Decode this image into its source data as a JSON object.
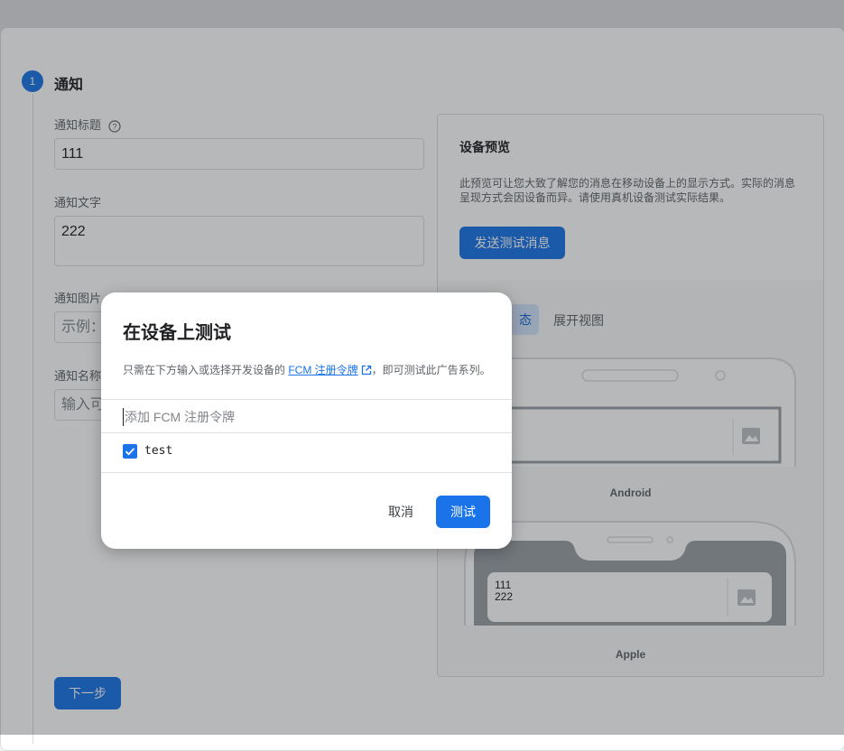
{
  "step": {
    "number": "1",
    "title": "通知"
  },
  "form": {
    "title_label": "通知标题",
    "title_value": "111",
    "text_label": "通知文字",
    "text_value": "222",
    "image_label": "通知图片",
    "image_placeholder": "示例：",
    "name_label": "通知名称",
    "name_placeholder": "输入可",
    "next_button": "下一步"
  },
  "preview": {
    "title": "设备预览",
    "description": "此预览可让您大致了解您的消息在移动设备上的显示方式。实际的消息呈现方式会因设备而异。请使用真机设备测试实际结果。",
    "send_test_button": "发送测试消息",
    "tab_collapsed": "态",
    "tab_expanded": "展开视图",
    "android_label": "Android",
    "apple_label": "Apple",
    "apple_notif_title": "111",
    "apple_notif_text": "222"
  },
  "dialog": {
    "title": "在设备上测试",
    "desc_before": "只需在下方输入或选择开发设备的 ",
    "desc_link": "FCM 注册令牌",
    "desc_after": "，即可测试此广告系列。",
    "token_placeholder": "添加 FCM 注册令牌",
    "token_item": "test",
    "cancel_button": "取消",
    "test_button": "测试"
  },
  "colors": {
    "accent": "#1a73e8",
    "scrim": "rgba(32,33,36,0.32)"
  }
}
